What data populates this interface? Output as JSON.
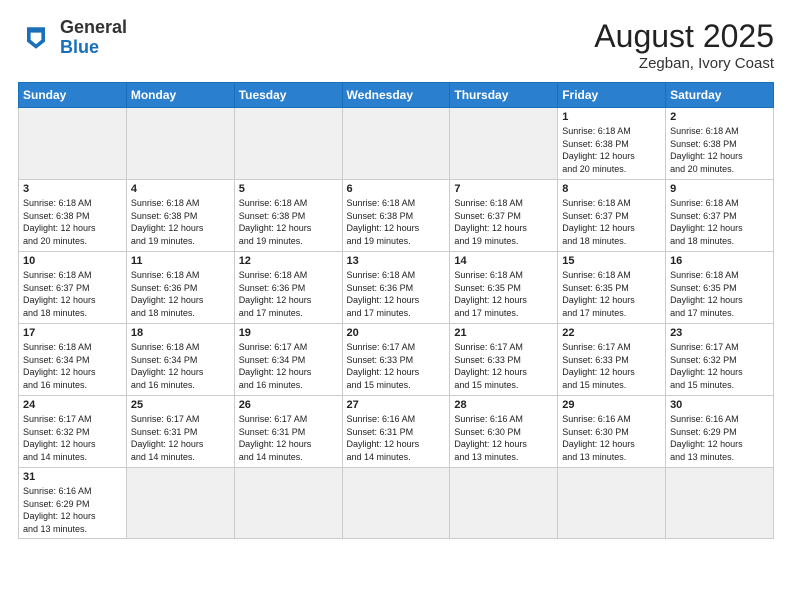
{
  "header": {
    "logo_general": "General",
    "logo_blue": "Blue",
    "month_year": "August 2025",
    "location": "Zegban, Ivory Coast"
  },
  "weekdays": [
    "Sunday",
    "Monday",
    "Tuesday",
    "Wednesday",
    "Thursday",
    "Friday",
    "Saturday"
  ],
  "weeks": [
    [
      {
        "day": "",
        "info": ""
      },
      {
        "day": "",
        "info": ""
      },
      {
        "day": "",
        "info": ""
      },
      {
        "day": "",
        "info": ""
      },
      {
        "day": "",
        "info": ""
      },
      {
        "day": "1",
        "info": "Sunrise: 6:18 AM\nSunset: 6:38 PM\nDaylight: 12 hours\nand 20 minutes."
      },
      {
        "day": "2",
        "info": "Sunrise: 6:18 AM\nSunset: 6:38 PM\nDaylight: 12 hours\nand 20 minutes."
      }
    ],
    [
      {
        "day": "3",
        "info": "Sunrise: 6:18 AM\nSunset: 6:38 PM\nDaylight: 12 hours\nand 20 minutes."
      },
      {
        "day": "4",
        "info": "Sunrise: 6:18 AM\nSunset: 6:38 PM\nDaylight: 12 hours\nand 19 minutes."
      },
      {
        "day": "5",
        "info": "Sunrise: 6:18 AM\nSunset: 6:38 PM\nDaylight: 12 hours\nand 19 minutes."
      },
      {
        "day": "6",
        "info": "Sunrise: 6:18 AM\nSunset: 6:38 PM\nDaylight: 12 hours\nand 19 minutes."
      },
      {
        "day": "7",
        "info": "Sunrise: 6:18 AM\nSunset: 6:37 PM\nDaylight: 12 hours\nand 19 minutes."
      },
      {
        "day": "8",
        "info": "Sunrise: 6:18 AM\nSunset: 6:37 PM\nDaylight: 12 hours\nand 18 minutes."
      },
      {
        "day": "9",
        "info": "Sunrise: 6:18 AM\nSunset: 6:37 PM\nDaylight: 12 hours\nand 18 minutes."
      }
    ],
    [
      {
        "day": "10",
        "info": "Sunrise: 6:18 AM\nSunset: 6:37 PM\nDaylight: 12 hours\nand 18 minutes."
      },
      {
        "day": "11",
        "info": "Sunrise: 6:18 AM\nSunset: 6:36 PM\nDaylight: 12 hours\nand 18 minutes."
      },
      {
        "day": "12",
        "info": "Sunrise: 6:18 AM\nSunset: 6:36 PM\nDaylight: 12 hours\nand 17 minutes."
      },
      {
        "day": "13",
        "info": "Sunrise: 6:18 AM\nSunset: 6:36 PM\nDaylight: 12 hours\nand 17 minutes."
      },
      {
        "day": "14",
        "info": "Sunrise: 6:18 AM\nSunset: 6:35 PM\nDaylight: 12 hours\nand 17 minutes."
      },
      {
        "day": "15",
        "info": "Sunrise: 6:18 AM\nSunset: 6:35 PM\nDaylight: 12 hours\nand 17 minutes."
      },
      {
        "day": "16",
        "info": "Sunrise: 6:18 AM\nSunset: 6:35 PM\nDaylight: 12 hours\nand 17 minutes."
      }
    ],
    [
      {
        "day": "17",
        "info": "Sunrise: 6:18 AM\nSunset: 6:34 PM\nDaylight: 12 hours\nand 16 minutes."
      },
      {
        "day": "18",
        "info": "Sunrise: 6:18 AM\nSunset: 6:34 PM\nDaylight: 12 hours\nand 16 minutes."
      },
      {
        "day": "19",
        "info": "Sunrise: 6:17 AM\nSunset: 6:34 PM\nDaylight: 12 hours\nand 16 minutes."
      },
      {
        "day": "20",
        "info": "Sunrise: 6:17 AM\nSunset: 6:33 PM\nDaylight: 12 hours\nand 15 minutes."
      },
      {
        "day": "21",
        "info": "Sunrise: 6:17 AM\nSunset: 6:33 PM\nDaylight: 12 hours\nand 15 minutes."
      },
      {
        "day": "22",
        "info": "Sunrise: 6:17 AM\nSunset: 6:33 PM\nDaylight: 12 hours\nand 15 minutes."
      },
      {
        "day": "23",
        "info": "Sunrise: 6:17 AM\nSunset: 6:32 PM\nDaylight: 12 hours\nand 15 minutes."
      }
    ],
    [
      {
        "day": "24",
        "info": "Sunrise: 6:17 AM\nSunset: 6:32 PM\nDaylight: 12 hours\nand 14 minutes."
      },
      {
        "day": "25",
        "info": "Sunrise: 6:17 AM\nSunset: 6:31 PM\nDaylight: 12 hours\nand 14 minutes."
      },
      {
        "day": "26",
        "info": "Sunrise: 6:17 AM\nSunset: 6:31 PM\nDaylight: 12 hours\nand 14 minutes."
      },
      {
        "day": "27",
        "info": "Sunrise: 6:16 AM\nSunset: 6:31 PM\nDaylight: 12 hours\nand 14 minutes."
      },
      {
        "day": "28",
        "info": "Sunrise: 6:16 AM\nSunset: 6:30 PM\nDaylight: 12 hours\nand 13 minutes."
      },
      {
        "day": "29",
        "info": "Sunrise: 6:16 AM\nSunset: 6:30 PM\nDaylight: 12 hours\nand 13 minutes."
      },
      {
        "day": "30",
        "info": "Sunrise: 6:16 AM\nSunset: 6:29 PM\nDaylight: 12 hours\nand 13 minutes."
      }
    ],
    [
      {
        "day": "31",
        "info": "Sunrise: 6:16 AM\nSunset: 6:29 PM\nDaylight: 12 hours\nand 13 minutes."
      },
      {
        "day": "",
        "info": ""
      },
      {
        "day": "",
        "info": ""
      },
      {
        "day": "",
        "info": ""
      },
      {
        "day": "",
        "info": ""
      },
      {
        "day": "",
        "info": ""
      },
      {
        "day": "",
        "info": ""
      }
    ]
  ]
}
